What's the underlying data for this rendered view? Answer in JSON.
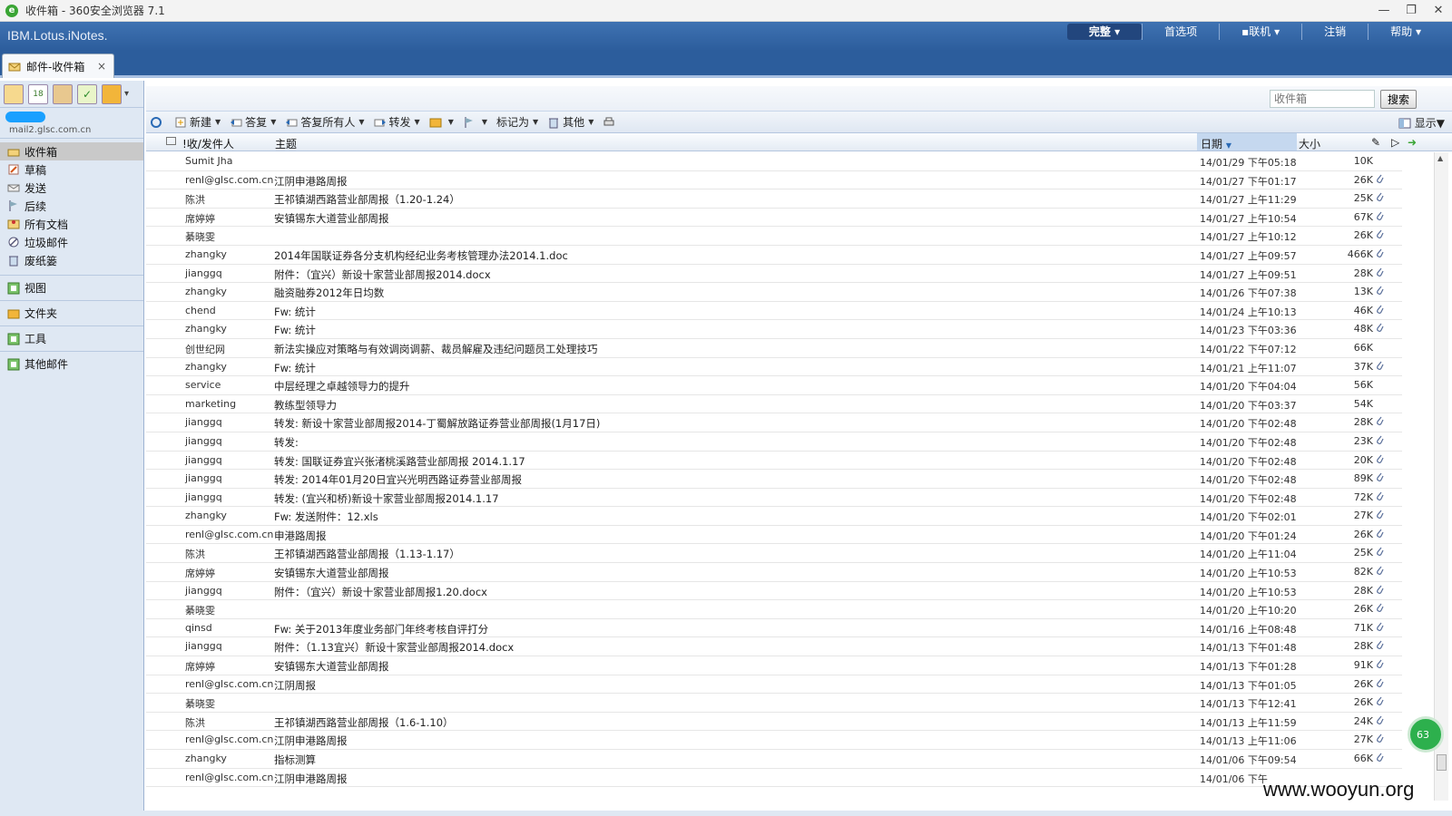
{
  "window": {
    "title": "收件箱 - 360安全浏览器 7.1"
  },
  "app": {
    "brand": "IBM.Lotus.iNotes.",
    "top_menu": [
      "完整",
      "首选项",
      "联机",
      "注销",
      "帮助"
    ]
  },
  "tab": {
    "label": "邮件-收件箱",
    "close": "×"
  },
  "user": {
    "address": "mail2.glsc.com.cn"
  },
  "folders": [
    {
      "label": "收件箱",
      "icon": "inbox-icon",
      "active": true
    },
    {
      "label": "草稿",
      "icon": "draft-icon",
      "active": false
    },
    {
      "label": "发送",
      "icon": "sent-icon",
      "active": false
    },
    {
      "label": "后续",
      "icon": "flag-icon",
      "active": false
    },
    {
      "label": "所有文档",
      "icon": "all-docs-icon",
      "active": false
    },
    {
      "label": "垃圾邮件",
      "icon": "junk-icon",
      "active": false
    },
    {
      "label": "废纸篓",
      "icon": "trash-icon",
      "active": false
    }
  ],
  "sections": [
    "视图",
    "文件夹",
    "工具",
    "其他邮件"
  ],
  "search": {
    "placeholder": "收件箱",
    "button": "搜索"
  },
  "toolbar": {
    "new": "新建",
    "reply": "答复",
    "reply_all": "答复所有人",
    "forward": "转发",
    "mark_as": "标记为",
    "other": "其他",
    "show": "显示"
  },
  "columns": {
    "sender": "!收/发件人",
    "subject": "主题",
    "date": "日期",
    "size": "大小",
    "sort_indicator": "▼"
  },
  "messages": [
    {
      "sender": "Sumit Jha",
      "subject": "",
      "date": "14/01/29 下午05:18",
      "size": "10K",
      "attach": false
    },
    {
      "sender": "renl@glsc.com.cn",
      "subject": "江阴申港路周报",
      "date": "14/01/27 下午01:17",
      "size": "26K",
      "attach": true
    },
    {
      "sender": "陈洪",
      "subject": "王祁镇湖西路营业部周报（1.20-1.24）",
      "date": "14/01/27 上午11:29",
      "size": "25K",
      "attach": true
    },
    {
      "sender": "席婷婷",
      "subject": "安镇锡东大道营业部周报",
      "date": "14/01/27 上午10:54",
      "size": "67K",
      "attach": true
    },
    {
      "sender": "綦晓雯",
      "subject": "",
      "date": "14/01/27 上午10:12",
      "size": "26K",
      "attach": true
    },
    {
      "sender": "zhangky",
      "subject": "2014年国联证券各分支机构经纪业务考核管理办法2014.1.doc",
      "date": "14/01/27 上午09:57",
      "size": "466K",
      "attach": true
    },
    {
      "sender": "jianggq",
      "subject": "附件：（宜兴）新设十家营业部周报2014.docx",
      "date": "14/01/27 上午09:51",
      "size": "28K",
      "attach": true
    },
    {
      "sender": "zhangky",
      "subject": "融资融券2012年日均数",
      "date": "14/01/26 下午07:38",
      "size": "13K",
      "attach": true
    },
    {
      "sender": "chend",
      "subject": "Fw: 统计",
      "date": "14/01/24 上午10:13",
      "size": "46K",
      "attach": true
    },
    {
      "sender": "zhangky",
      "subject": "Fw: 统计",
      "date": "14/01/23 下午03:36",
      "size": "48K",
      "attach": true
    },
    {
      "sender": "创世纪网",
      "subject": "新法实操应对策略与有效调岗调薪、裁员解雇及违纪问题员工处理技巧",
      "date": "14/01/22 下午07:12",
      "size": "66K",
      "attach": false
    },
    {
      "sender": "zhangky",
      "subject": "Fw: 统计",
      "date": "14/01/21 上午11:07",
      "size": "37K",
      "attach": true
    },
    {
      "sender": "service",
      "subject": "中层经理之卓越领导力的提升",
      "date": "14/01/20 下午04:04",
      "size": "56K",
      "attach": false
    },
    {
      "sender": "marketing",
      "subject": "教练型领导力",
      "date": "14/01/20 下午03:37",
      "size": "54K",
      "attach": false
    },
    {
      "sender": "jianggq",
      "subject": "转发: 新设十家营业部周报2014-丁蜀解放路证券营业部周报(1月17日)",
      "date": "14/01/20 下午02:48",
      "size": "28K",
      "attach": true
    },
    {
      "sender": "jianggq",
      "subject": "转发:",
      "date": "14/01/20 下午02:48",
      "size": "23K",
      "attach": true
    },
    {
      "sender": "jianggq",
      "subject": "转发: 国联证券宜兴张渚桃溪路营业部周报 2014.1.17",
      "date": "14/01/20 下午02:48",
      "size": "20K",
      "attach": true
    },
    {
      "sender": "jianggq",
      "subject": "转发: 2014年01月20日宜兴光明西路证券营业部周报",
      "date": "14/01/20 下午02:48",
      "size": "89K",
      "attach": true
    },
    {
      "sender": "jianggq",
      "subject": "转发: (宜兴和桥)新设十家营业部周报2014.1.17",
      "date": "14/01/20 下午02:48",
      "size": "72K",
      "attach": true
    },
    {
      "sender": "zhangky",
      "subject": "Fw: 发送附件：12.xls",
      "date": "14/01/20 下午02:01",
      "size": "27K",
      "attach": true
    },
    {
      "sender": "renl@glsc.com.cn",
      "subject": "申港路周报",
      "date": "14/01/20 下午01:24",
      "size": "26K",
      "attach": true
    },
    {
      "sender": "陈洪",
      "subject": "王祁镇湖西路营业部周报（1.13-1.17）",
      "date": "14/01/20 上午11:04",
      "size": "25K",
      "attach": true
    },
    {
      "sender": "席婷婷",
      "subject": "安镇锡东大道营业部周报",
      "date": "14/01/20 上午10:53",
      "size": "82K",
      "attach": true
    },
    {
      "sender": "jianggq",
      "subject": "附件：（宜兴）新设十家营业部周报1.20.docx",
      "date": "14/01/20 上午10:53",
      "size": "28K",
      "attach": true
    },
    {
      "sender": "綦晓雯",
      "subject": "",
      "date": "14/01/20 上午10:20",
      "size": "26K",
      "attach": true
    },
    {
      "sender": "qinsd",
      "subject": "Fw: 关于2013年度业务部门年终考核自评打分",
      "date": "14/01/16 上午08:48",
      "size": "71K",
      "attach": true
    },
    {
      "sender": "jianggq",
      "subject": "附件：（1.13宜兴）新设十家营业部周报2014.docx",
      "date": "14/01/13 下午01:48",
      "size": "28K",
      "attach": true
    },
    {
      "sender": "席婷婷",
      "subject": "安镇锡东大道营业部周报",
      "date": "14/01/13 下午01:28",
      "size": "91K",
      "attach": true
    },
    {
      "sender": "renl@glsc.com.cn",
      "subject": "江阴周报",
      "date": "14/01/13 下午01:05",
      "size": "26K",
      "attach": true
    },
    {
      "sender": "綦晓雯",
      "subject": "",
      "date": "14/01/13 下午12:41",
      "size": "26K",
      "attach": true
    },
    {
      "sender": "陈洪",
      "subject": "王祁镇湖西路营业部周报（1.6-1.10）",
      "date": "14/01/13 上午11:59",
      "size": "24K",
      "attach": true
    },
    {
      "sender": "renl@glsc.com.cn",
      "subject": "江阴申港路周报",
      "date": "14/01/13 上午11:06",
      "size": "27K",
      "attach": true
    },
    {
      "sender": "zhangky",
      "subject": "指标测算",
      "date": "14/01/06 下午09:54",
      "size": "66K",
      "attach": true
    },
    {
      "sender": "renl@glsc.com.cn",
      "subject": "江阴申港路周报",
      "date": "14/01/06 下午",
      "size": "",
      "attach": false
    }
  ],
  "badge": "63",
  "watermark": "www.wooyun.org",
  "colors": {
    "header_blue": "#2c5d9c",
    "pane_bg": "#dfe8f3",
    "selected_folder": "#c9c9c9"
  }
}
